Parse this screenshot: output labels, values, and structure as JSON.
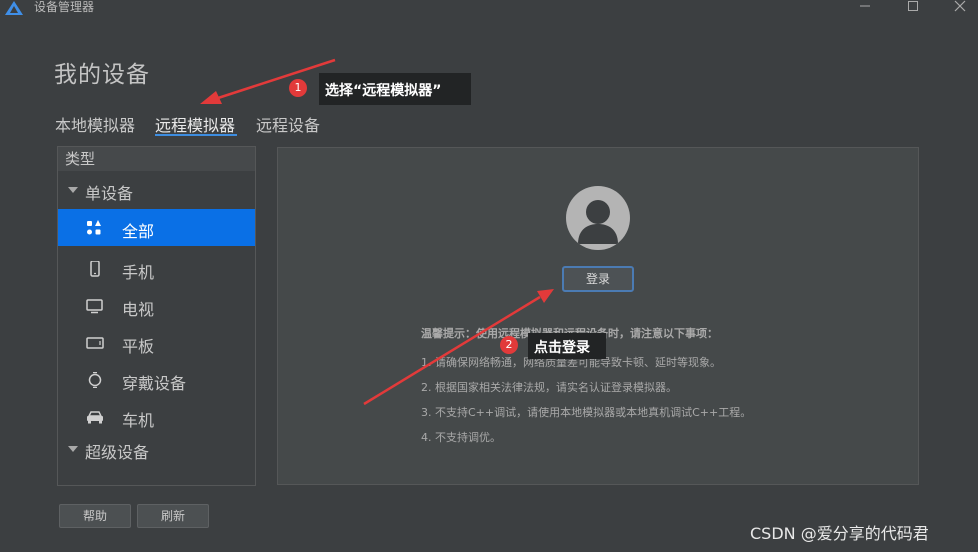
{
  "window": {
    "title": "设备管理器",
    "controls": [
      "minimize-icon",
      "maximize-icon",
      "close-icon"
    ]
  },
  "page_title": "我的设备",
  "tabs": [
    {
      "label": "本地模拟器",
      "selected": false
    },
    {
      "label": "远程模拟器",
      "selected": true
    },
    {
      "label": "远程设备",
      "selected": false
    }
  ],
  "sidebar": {
    "header": "类型",
    "group_single": "单设备",
    "items": [
      {
        "label": "全部",
        "icon": "grid-shapes-icon",
        "active": true
      },
      {
        "label": "手机",
        "icon": "phone-icon",
        "active": false
      },
      {
        "label": "电视",
        "icon": "tv-icon",
        "active": false
      },
      {
        "label": "平板",
        "icon": "tablet-icon",
        "active": false
      },
      {
        "label": "穿戴设备",
        "icon": "watch-icon",
        "active": false
      },
      {
        "label": "车机",
        "icon": "car-icon",
        "active": false
      }
    ],
    "group_super": "超级设备"
  },
  "bottom_buttons": {
    "help": "帮助",
    "refresh": "刷新"
  },
  "login_panel": {
    "avatar_icon": "user-avatar-icon",
    "login_button": "登录",
    "notice_title": "温馨提示：使用远程模拟器和远程设备时，请注意以下事项：",
    "notice_lines": [
      "1. 请确保网络畅通，网络质量差可能导致卡顿、延时等现象。",
      "2. 根据国家相关法律法规，请实名认证登录模拟器。",
      "3. 不支持C++调试，请使用本地模拟器或本地真机调试C++工程。",
      "4. 不支持调优。"
    ]
  },
  "annotations": [
    {
      "number": "1",
      "text": "选择“远程模拟器”"
    },
    {
      "number": "2",
      "text": "点击登录"
    }
  ],
  "colors": {
    "accent": "#0a70e6",
    "annotation_red": "#e23a3a",
    "callout_bg": "#222425"
  },
  "watermark": "CSDN @爱分享的代码君"
}
